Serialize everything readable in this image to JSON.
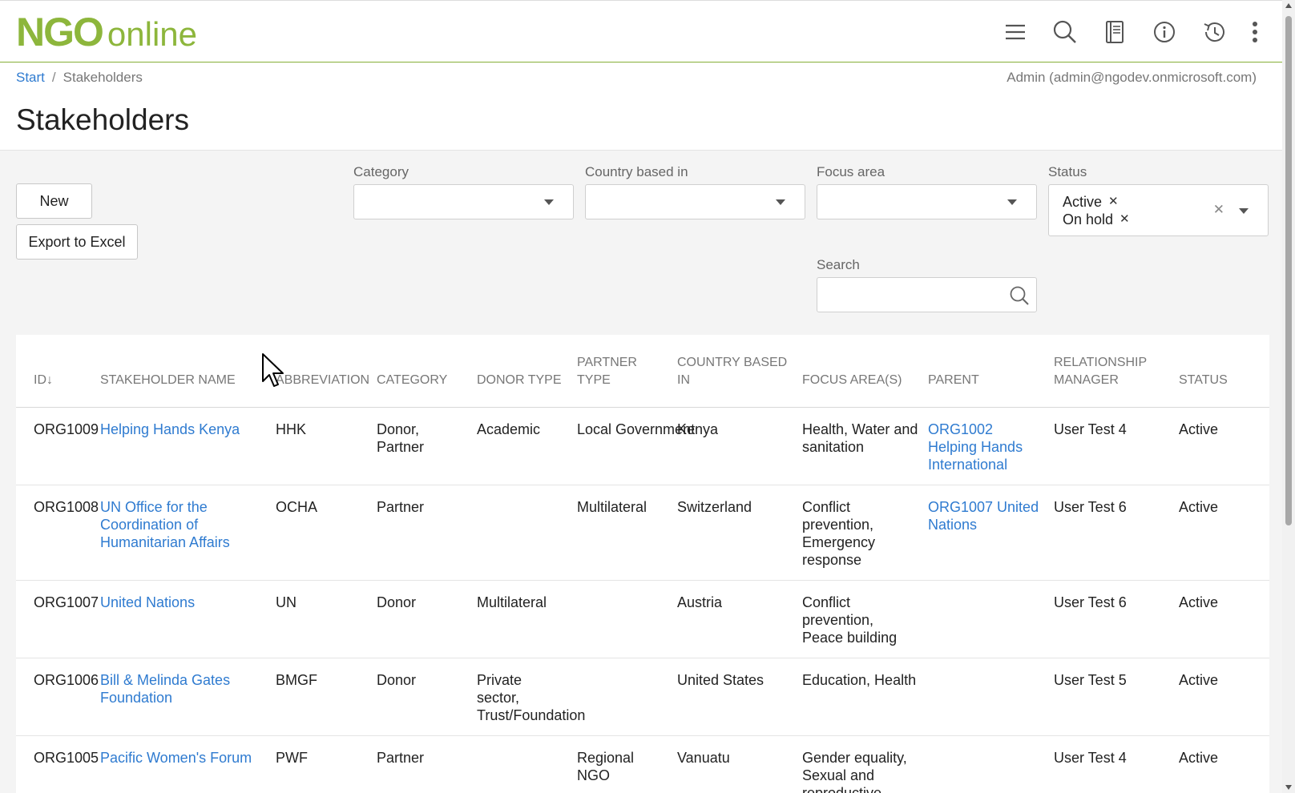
{
  "app": {
    "logo_main": "NGO",
    "logo_sub": "online"
  },
  "icons": {
    "menu": "hamburger-menu-icon",
    "search": "search-icon",
    "notes": "notebook-icon",
    "info": "info-icon",
    "history": "history-icon",
    "more": "kebab-menu-icon"
  },
  "breadcrumb": {
    "start": "Start",
    "current": "Stakeholders"
  },
  "user": "Admin (admin@ngodev.onmicrosoft.com)",
  "page_title": "Stakeholders",
  "actions": {
    "new_label": "New",
    "export_label": "Export to Excel"
  },
  "filters": {
    "category_label": "Category",
    "country_label": "Country based in",
    "focus_label": "Focus area",
    "status_label": "Status",
    "status_chips": [
      "Active",
      "On hold"
    ],
    "search_label": "Search",
    "search_value": ""
  },
  "table": {
    "columns": [
      "ID↓",
      "STAKEHOLDER NAME",
      "ABBREVIATION",
      "CATEGORY",
      "DONOR TYPE",
      "PARTNER TYPE",
      "COUNTRY BASED IN",
      "FOCUS AREA(S)",
      "PARENT",
      "RELATIONSHIP MANAGER",
      "STATUS"
    ],
    "rows": [
      {
        "id": "ORG1009",
        "name": "Helping Hands Kenya",
        "abbr": "HHK",
        "category": "Donor, Partner",
        "donor_type": "Academic",
        "partner_type": "Local Government",
        "country": "Kenya",
        "focus": "Health, Water and sanitation",
        "parent": "ORG1002 Helping Hands International",
        "manager": "User Test 4",
        "status": "Active"
      },
      {
        "id": "ORG1008",
        "name": "UN Office for the Coordination of Humanitarian Affairs",
        "abbr": "OCHA",
        "category": "Partner",
        "donor_type": "",
        "partner_type": "Multilateral",
        "country": "Switzerland",
        "focus": "Conflict prevention, Emergency response",
        "parent": "ORG1007 United Nations",
        "manager": "User Test 6",
        "status": "Active"
      },
      {
        "id": "ORG1007",
        "name": "United Nations",
        "abbr": "UN",
        "category": "Donor",
        "donor_type": "Multilateral",
        "partner_type": "",
        "country": "Austria",
        "focus": "Conflict prevention, Peace building",
        "parent": "",
        "manager": "User Test 6",
        "status": "Active"
      },
      {
        "id": "ORG1006",
        "name": "Bill & Melinda Gates Foundation",
        "abbr": "BMGF",
        "category": "Donor",
        "donor_type": "Private sector, Trust/Foundation",
        "partner_type": "",
        "country": "United States",
        "focus": "Education, Health",
        "parent": "",
        "manager": "User Test 5",
        "status": "Active"
      },
      {
        "id": "ORG1005",
        "name": "Pacific Women's Forum",
        "abbr": "PWF",
        "category": "Partner",
        "donor_type": "",
        "partner_type": "Regional NGO",
        "country": "Vanuatu",
        "focus": "Gender equality, Sexual and reproductive health",
        "parent": "",
        "manager": "User Test 4",
        "status": "Active"
      }
    ]
  },
  "colors": {
    "brand": "#8db63c",
    "link": "#2f7bd0"
  }
}
